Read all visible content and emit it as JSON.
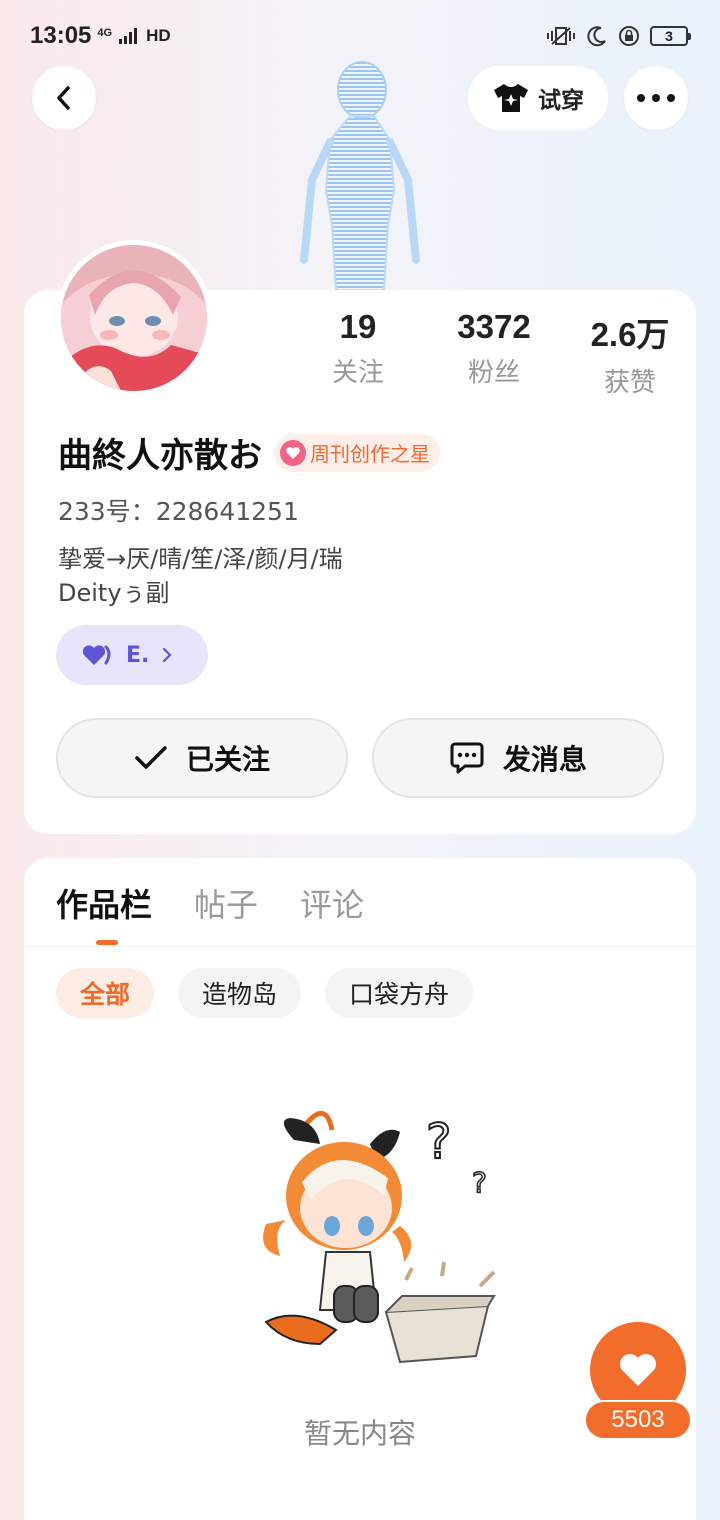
{
  "status_bar": {
    "time": "13:05",
    "network": "4G",
    "hd": "HD",
    "battery": "3"
  },
  "header": {
    "try_on_label": "试穿"
  },
  "profile": {
    "stats": [
      {
        "value": "19",
        "label": "关注"
      },
      {
        "value": "3372",
        "label": "粉丝"
      },
      {
        "value": "2.6万",
        "label": "获赞"
      }
    ],
    "username": "曲終人亦散お",
    "badge_label": "周刊创作之星",
    "uid": "233号：228641251",
    "bio_line1": "挚爱→厌/晴/笙/泽/颜/月/瑞",
    "bio_line2": "Deityぅ副",
    "tag_label": "E.",
    "follow_label": "已关注",
    "message_label": "发消息"
  },
  "tabs": [
    {
      "label": "作品栏",
      "active": true
    },
    {
      "label": "帖子",
      "active": false
    },
    {
      "label": "评论",
      "active": false
    }
  ],
  "filters": [
    {
      "label": "全部",
      "active": true
    },
    {
      "label": "造物岛",
      "active": false
    },
    {
      "label": "口袋方舟",
      "active": false
    }
  ],
  "empty_text": "暂无内容",
  "like_count": "5503",
  "colors": {
    "accent": "#f26d2b",
    "tag_purple": "#5d55d6"
  }
}
